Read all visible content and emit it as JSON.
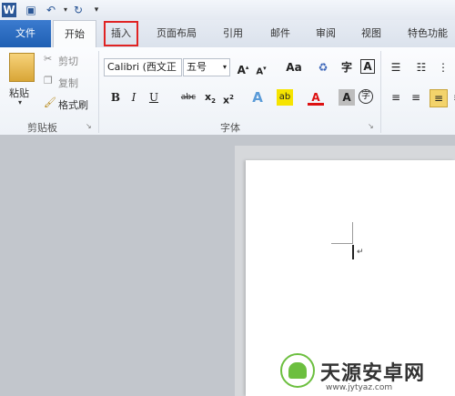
{
  "tabs": {
    "file": "文件",
    "home": "开始",
    "insert": "插入",
    "layout": "页面布局",
    "references": "引用",
    "mailings": "邮件",
    "review": "审阅",
    "view": "视图",
    "special": "特色功能"
  },
  "clipboard": {
    "paste": "粘贴",
    "cut": "剪切",
    "copy": "复制",
    "format_painter": "格式刷",
    "label": "剪贴板"
  },
  "font": {
    "name": "Calibri (西文正",
    "size": "五号",
    "label": "字体",
    "aa": "Aa"
  },
  "icons": [
    "word-icon",
    "save-icon",
    "undo-icon",
    "redo-icon",
    "customize-icon"
  ],
  "watermark": {
    "brand": "天源安卓网",
    "url": "www.jytyaz.com"
  }
}
